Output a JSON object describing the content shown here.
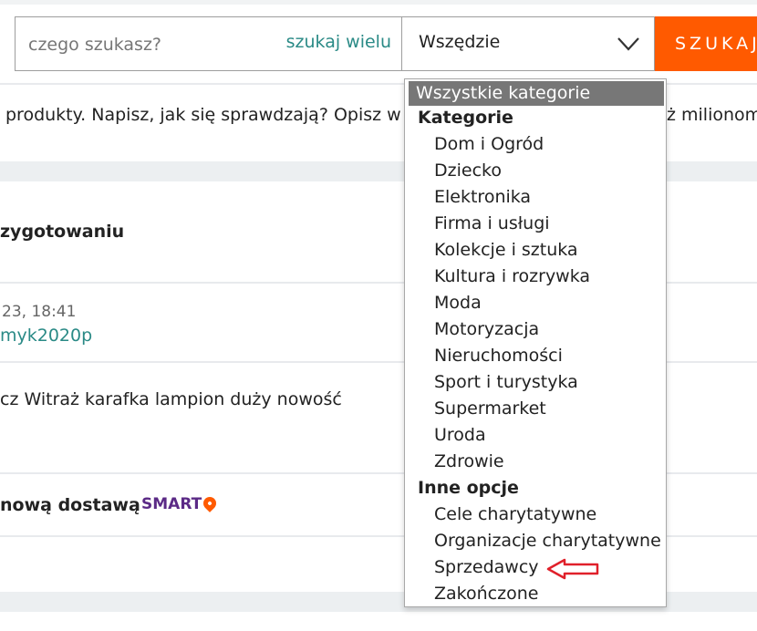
{
  "search": {
    "placeholder": "czego szukasz?",
    "search_many_label": "szukaj wielu",
    "scope_value": "Wszędzie",
    "button_label": "SZUKAJ"
  },
  "background": {
    "line1": "produkty. Napisz, jak się sprawdzają? Opisz w",
    "line1_right": "ż milionom",
    "heading": "zygotowaniu",
    "date": "23, 18:41",
    "seller": "myk2020p",
    "product": "cz Witraż karafka lampion duży nowość",
    "delivery": "nową dostawą",
    "smart_logo": "SMART"
  },
  "dropdown": {
    "selected": "Wszystkie kategorie",
    "group1_label": "Kategorie",
    "group1_items": [
      "Dom i Ogród",
      "Dziecko",
      "Elektronika",
      "Firma i usługi",
      "Kolekcje i sztuka",
      "Kultura i rozrywka",
      "Moda",
      "Motoryzacja",
      "Nieruchomości",
      "Sport i turystyka",
      "Supermarket",
      "Uroda",
      "Zdrowie"
    ],
    "group2_label": "Inne opcje",
    "group2_items": [
      "Cele charytatywne",
      "Organizacje charytatywne",
      "Sprzedawcy",
      "Zakończone"
    ]
  },
  "colors": {
    "accent_orange": "#ff5a00",
    "teal_link": "#2a8a86",
    "dropdown_highlight": "#777777",
    "annotation_red": "#e0202a"
  }
}
